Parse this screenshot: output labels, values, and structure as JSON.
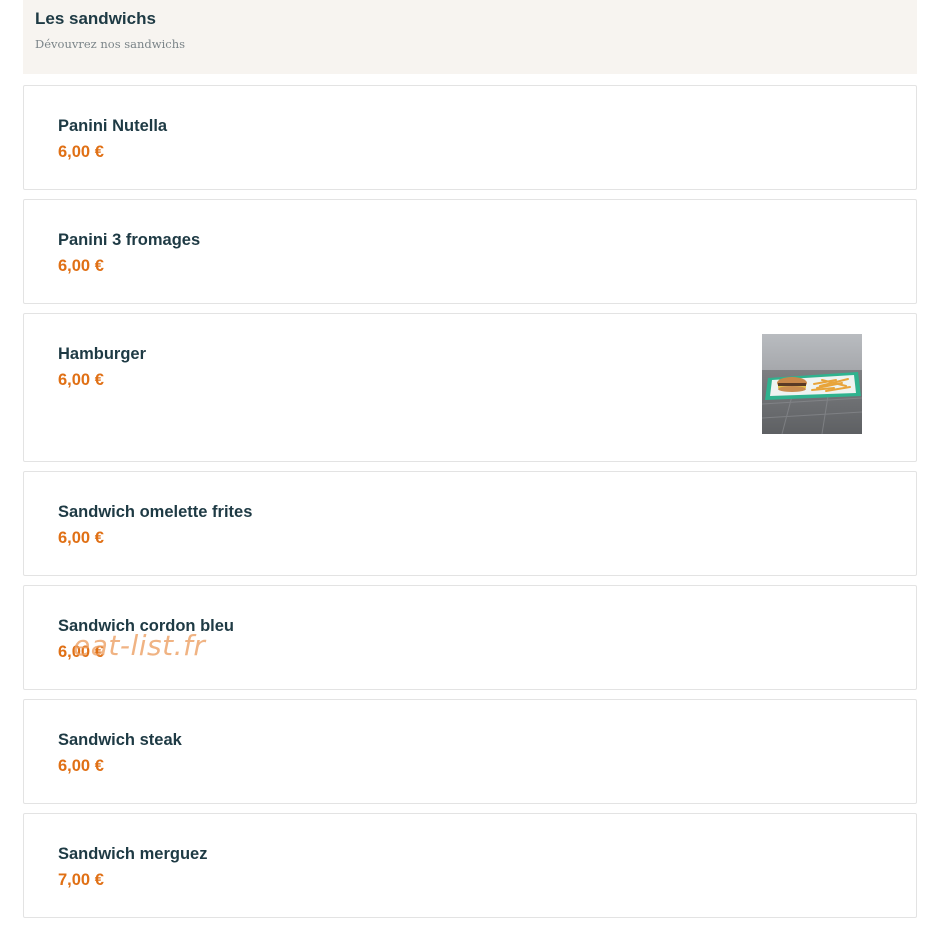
{
  "category": {
    "title": "Les sandwichs",
    "subtitle": "Dévouvrez nos sandwichs"
  },
  "items": [
    {
      "name": "Panini Nutella",
      "price": "6,00 €"
    },
    {
      "name": "Panini 3 fromages",
      "price": "6,00 €"
    },
    {
      "name": "Hamburger",
      "price": "6,00 €",
      "image": "burger-fries-tray-photo"
    },
    {
      "name": "Sandwich omelette frites",
      "price": "6,00 €"
    },
    {
      "name": "Sandwich cordon bleu",
      "price": "6,00 €"
    },
    {
      "name": "Sandwich steak",
      "price": "6,00 €"
    },
    {
      "name": "Sandwich merguez",
      "price": "7,00 €"
    }
  ],
  "watermark": "eat-list.fr",
  "colors": {
    "text": "#1e3a44",
    "price": "#e07015",
    "header_bg": "#f7f4f0",
    "border": "#e3e3e3"
  }
}
